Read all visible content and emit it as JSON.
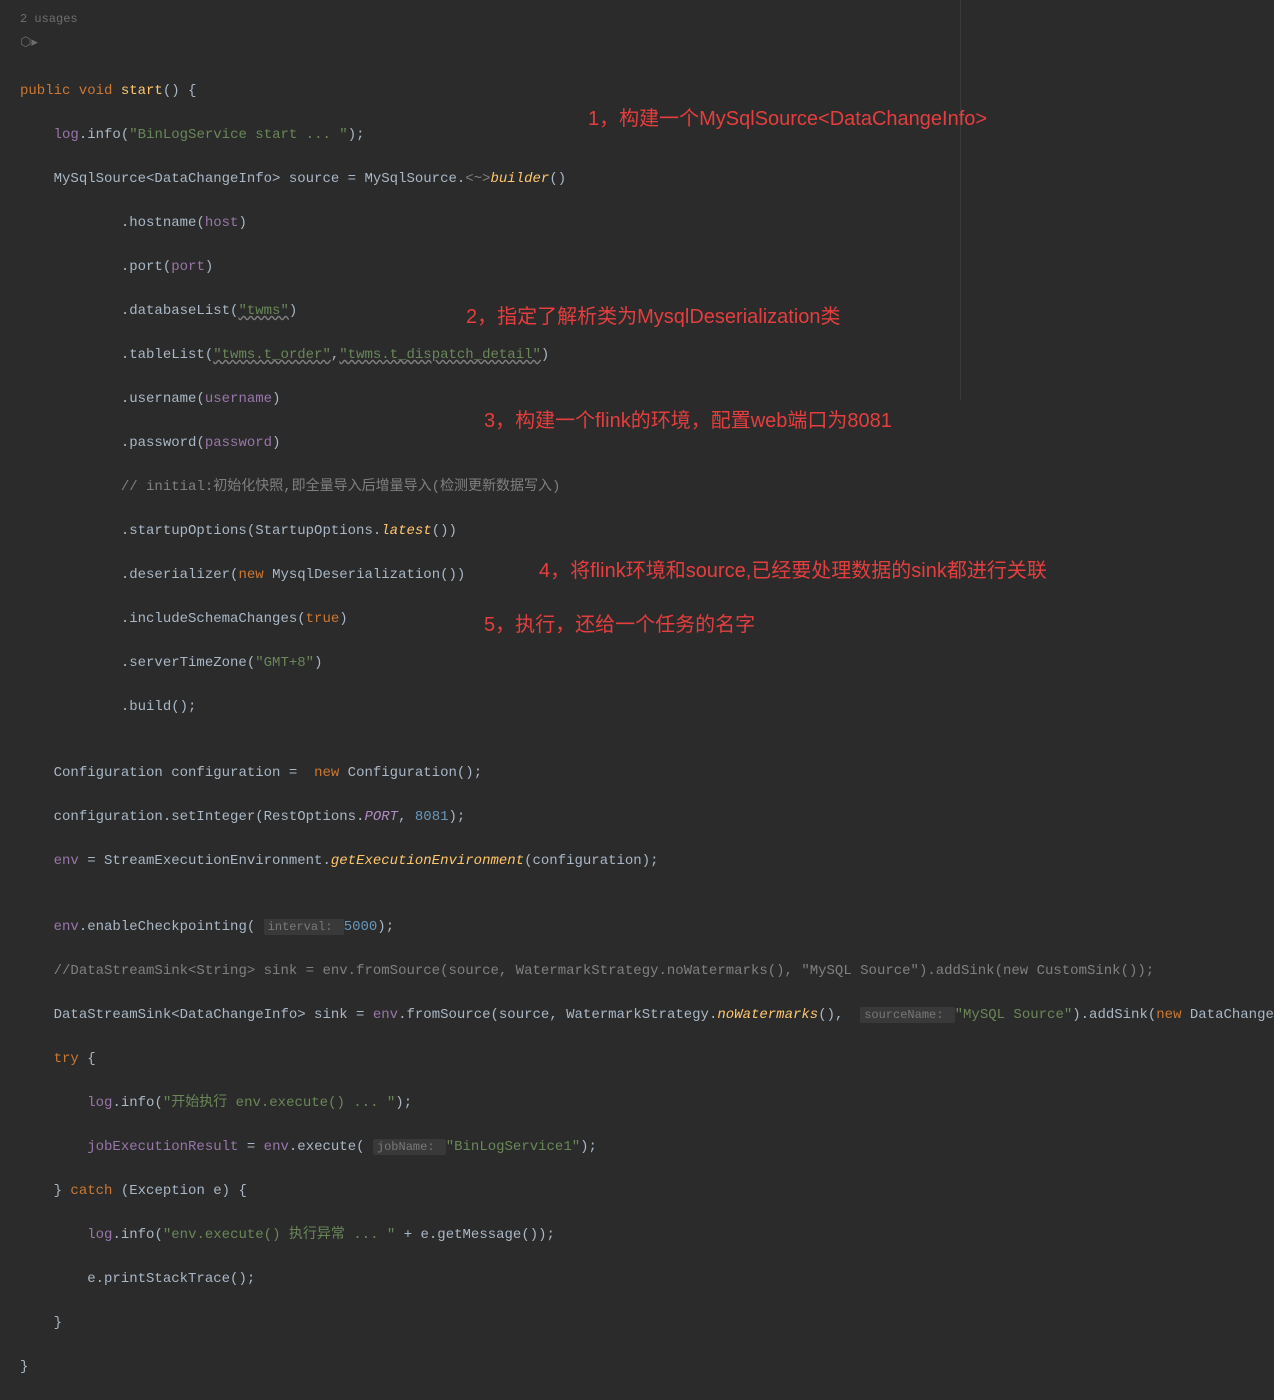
{
  "header": {
    "usages": "2 usages",
    "icon": "⬡▸"
  },
  "c": {
    "l01_pre": "public void ",
    "l01_method": "start",
    "l01_post": "() {",
    "l02_indent": "    ",
    "l02_a": "log",
    "l02_b": ".info(",
    "l02_c": "\"BinLogService start ... \"",
    "l02_d": ");",
    "l03_indent": "    ",
    "l03_a": "MySqlSource<DataChangeInfo> source = MySqlSource.",
    "l03_b": "<~>",
    "l03_c": "builder",
    "l03_d": "()",
    "l04_indent": "            .",
    "l04_a": "hostname",
    "l04_b": "(",
    "l04_c": "host",
    "l04_d": ")",
    "l05_indent": "            .",
    "l05_a": "port",
    "l05_b": "(",
    "l05_c": "port",
    "l05_d": ")",
    "l06_indent": "            .",
    "l06_a": "databaseList",
    "l06_b": "(",
    "l06_c": "\"twms\"",
    "l06_d": ")",
    "l07_indent": "            .",
    "l07_a": "tableList",
    "l07_b": "(",
    "l07_c": "\"twms.t_order\"",
    "l07_c2": ",",
    "l07_d": "\"twms.t_dispatch_detail\"",
    "l07_e": ")",
    "l08_indent": "            .",
    "l08_a": "username",
    "l08_b": "(",
    "l08_c": "username",
    "l08_d": ")",
    "l09_indent": "            .",
    "l09_a": "password",
    "l09_b": "(",
    "l09_c": "password",
    "l09_d": ")",
    "l10_indent": "            ",
    "l10_a": "// initial:初始化快照,即全量导入后增量导入(检测更新数据写入)",
    "l11_indent": "            .",
    "l11_a": "startupOptions",
    "l11_b": "(StartupOptions.",
    "l11_c": "latest",
    "l11_d": "())",
    "l12_indent": "            .",
    "l12_a": "deserializer",
    "l12_b": "(",
    "l12_c": "new ",
    "l12_d": "MysqlDeserialization())",
    "l13_indent": "            .",
    "l13_a": "includeSchemaChanges",
    "l13_b": "(",
    "l13_c": "true",
    "l13_d": ")",
    "l14_indent": "            .",
    "l14_a": "serverTimeZone",
    "l14_b": "(",
    "l14_c": "\"GMT+8\"",
    "l14_d": ")",
    "l15_indent": "            .",
    "l15_a": "build",
    "l15_b": "();",
    "l16": "",
    "l17_indent": "    ",
    "l17_a": "Configuration configuration =  ",
    "l17_b": "new ",
    "l17_c": "Configuration();",
    "l18_indent": "    ",
    "l18_a": "configuration.setInteger(RestOptions.",
    "l18_b": "PORT",
    "l18_c": ", ",
    "l18_d": "8081",
    "l18_e": ");",
    "l19_indent": "    ",
    "l19_a": "env ",
    "l19_b": "= StreamExecutionEnvironment.",
    "l19_c": "getExecutionEnvironment",
    "l19_d": "(configuration);",
    "l20": "",
    "l21_indent": "    ",
    "l21_a": "env",
    "l21_b": ".enableCheckpointing( ",
    "l21_hint": "interval: ",
    "l21_c": "5000",
    "l21_d": ");",
    "l22_indent": "    ",
    "l22_a": "//DataStreamSink<String> sink = env.fromSource(source, WatermarkStrategy.noWatermarks(), \"MySQL Source\").addSink(new CustomSink());",
    "l23_indent": "    ",
    "l23_a": "DataStreamSink<DataChangeInfo> sink = ",
    "l23_b": "env",
    "l23_c": ".fromSource(source, WatermarkStrategy.",
    "l23_d": "noWatermarks",
    "l23_e": "(),  ",
    "l23_hint": "sourceName: ",
    "l23_f": "\"MySQL Source\"",
    "l23_g": ").addSink(",
    "l23_h": "new ",
    "l23_i": "DataChangeSink());",
    "l24_indent": "    ",
    "l24_a": "try ",
    "l24_b": "{",
    "l25_indent": "        ",
    "l25_a": "log",
    "l25_b": ".info(",
    "l25_c": "\"开始执行 env.execute() ... \"",
    "l25_d": ");",
    "l26_indent": "        ",
    "l26_a": "jobExecutionResult ",
    "l26_b": "= ",
    "l26_c": "env",
    "l26_d": ".execute( ",
    "l26_hint": "jobName: ",
    "l26_e": "\"BinLogService1\"",
    "l26_f": ");",
    "l27_indent": "    ",
    "l27_a": "} ",
    "l27_b": "catch ",
    "l27_c": "(Exception e) {",
    "l28_indent": "        ",
    "l28_a": "log",
    "l28_b": ".info(",
    "l28_c": "\"env.execute() 执行异常 ... \" ",
    "l28_d": "+ e.getMessage());",
    "l29_indent": "        ",
    "l29_a": "e.printStackTrace();",
    "l30_indent": "    ",
    "l30_a": "}",
    "l31": "}"
  },
  "anno": {
    "a1": "1，构建一个MySqlSource<DataChangeInfo>",
    "a2": "2，指定了解析类为MysqlDeserialization类",
    "a3": "3，构建一个flink的环境，配置web端口为8081",
    "a4": "4，将flink环境和source,已经要处理数据的sink都进行关联",
    "a5": "5，执行，还给一个任务的名字"
  }
}
